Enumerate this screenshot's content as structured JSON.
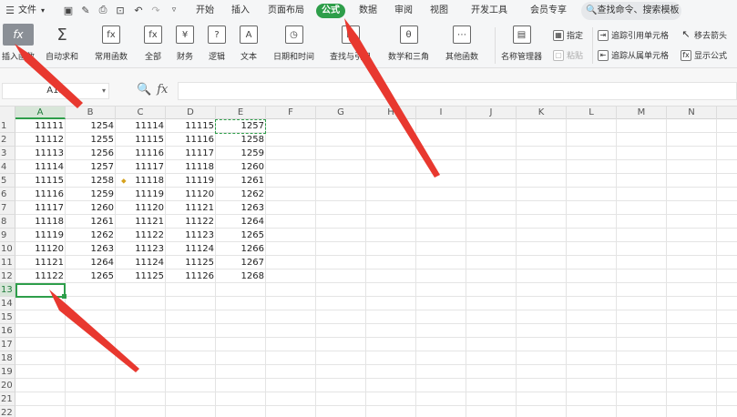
{
  "menubar": {
    "file": "文件",
    "tabs": [
      "开始",
      "插入",
      "页面布局",
      "公式",
      "数据",
      "审阅",
      "视图",
      "开发工具",
      "会员专享"
    ],
    "active_tab": "公式",
    "search": "查找命令、搜索模板"
  },
  "ribbon": {
    "insert_function": "插入函数",
    "groups": [
      {
        "label": "自动求和",
        "icon": "Σ"
      },
      {
        "label": "常用函数",
        "icon": "fx"
      },
      {
        "label": "全部",
        "icon": "fx"
      },
      {
        "label": "财务",
        "icon": "¥"
      },
      {
        "label": "逻辑",
        "icon": "?"
      },
      {
        "label": "文本",
        "icon": "A"
      },
      {
        "label": "日期和时间",
        "icon": "◷"
      },
      {
        "label": "查找与引用",
        "icon": "⊡"
      },
      {
        "label": "数学和三角",
        "icon": "θ"
      },
      {
        "label": "其他函数",
        "icon": "⋯"
      },
      {
        "label": "名称管理器",
        "icon": "▤"
      }
    ],
    "specify": "指定",
    "paste": "粘贴",
    "trace_precedents": "追踪引用单元格",
    "trace_dependents": "追踪从属单元格",
    "remove_arrows": "移去箭头",
    "show_formulas": "显示公式"
  },
  "formula_bar": {
    "name_box": "A13",
    "fx": "fx",
    "formula": ""
  },
  "sheet": {
    "columns": [
      "A",
      "B",
      "C",
      "D",
      "E",
      "F",
      "G",
      "H",
      "I",
      "J",
      "K",
      "L",
      "M",
      "N"
    ],
    "rows": [
      "1",
      "2",
      "3",
      "4",
      "5",
      "6",
      "7",
      "8",
      "9",
      "10",
      "11",
      "12",
      "13",
      "14",
      "15",
      "16",
      "17",
      "18",
      "19",
      "20",
      "21",
      "22"
    ],
    "active_column": "A",
    "active_row": "13",
    "data": [
      [
        "11111",
        "1254",
        "11114",
        "11115",
        "1257"
      ],
      [
        "11112",
        "1255",
        "11115",
        "11116",
        "1258"
      ],
      [
        "11113",
        "1256",
        "11116",
        "11117",
        "1259"
      ],
      [
        "11114",
        "1257",
        "11117",
        "11118",
        "1260"
      ],
      [
        "11115",
        "1258",
        "11118",
        "11119",
        "1261"
      ],
      [
        "11116",
        "1259",
        "11119",
        "11120",
        "1262"
      ],
      [
        "11117",
        "1260",
        "11120",
        "11121",
        "1263"
      ],
      [
        "11118",
        "1261",
        "11121",
        "11122",
        "1264"
      ],
      [
        "11119",
        "1262",
        "11122",
        "11123",
        "1265"
      ],
      [
        "11120",
        "1263",
        "11123",
        "11124",
        "1266"
      ],
      [
        "11121",
        "1264",
        "11124",
        "11125",
        "1267"
      ],
      [
        "11122",
        "1265",
        "11125",
        "11126",
        "1268"
      ]
    ]
  },
  "colors": {
    "accent": "#2e9e4a",
    "arrow": "#e8382f"
  }
}
